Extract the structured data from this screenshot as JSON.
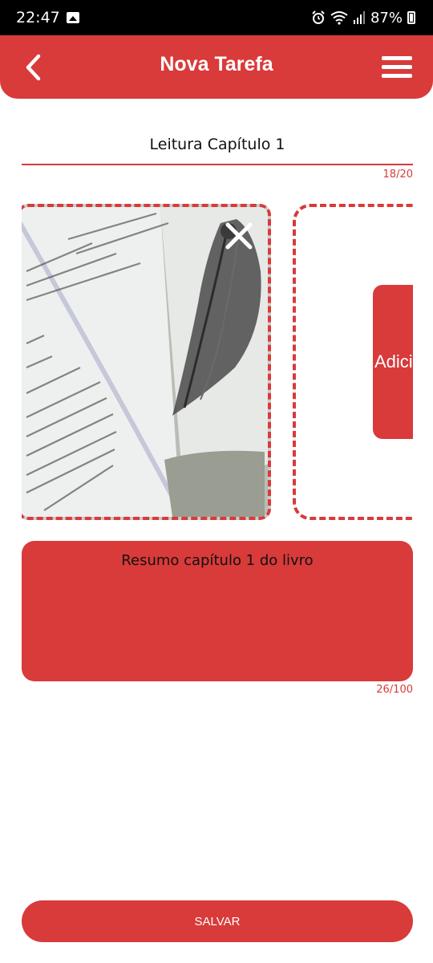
{
  "status_bar": {
    "time": "22:47",
    "battery": "87%",
    "icons": [
      "gallery-icon",
      "alarm-icon",
      "wifi-icon",
      "signal-icon",
      "battery-icon"
    ]
  },
  "header": {
    "title": "Nova Tarefa",
    "back_icon": "chevron-left-icon",
    "menu_icon": "hamburger-menu-icon"
  },
  "task": {
    "title_value": "Leitura Capítulo 1",
    "title_counter": "18/20",
    "description": "Resumo capítulo 1 do livro",
    "description_counter": "26/100"
  },
  "images": {
    "photo_description": "book-page-illustration-photo",
    "remove_icon": "close-icon",
    "add_label": "Adici"
  },
  "actions": {
    "save_label": "SALVAR"
  },
  "colors": {
    "accent": "#d93a3a",
    "background": "#ffffff",
    "status_bar": "#000000"
  }
}
